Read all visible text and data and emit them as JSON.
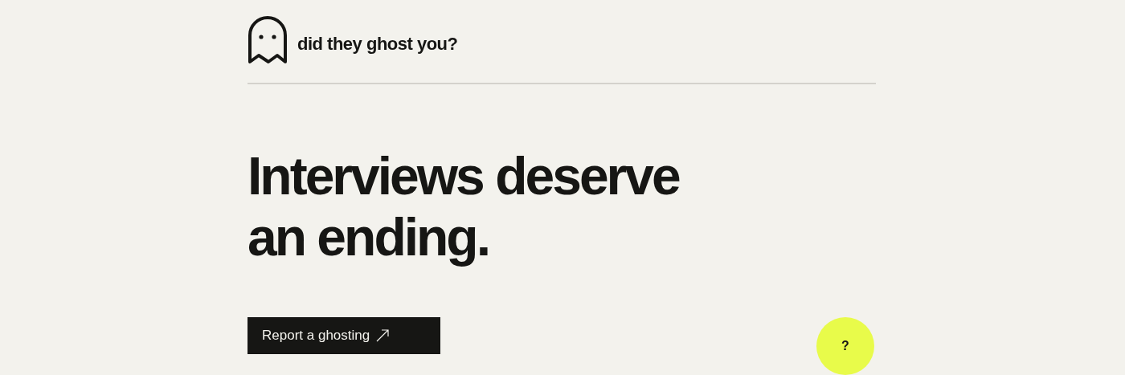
{
  "header": {
    "brand": "did they ghost you?"
  },
  "hero": {
    "headline_lines": [
      "Interviews deserve",
      "an ending."
    ]
  },
  "cta_button": {
    "label": "Report a ghosting"
  },
  "help_button": {
    "label": "?"
  }
}
